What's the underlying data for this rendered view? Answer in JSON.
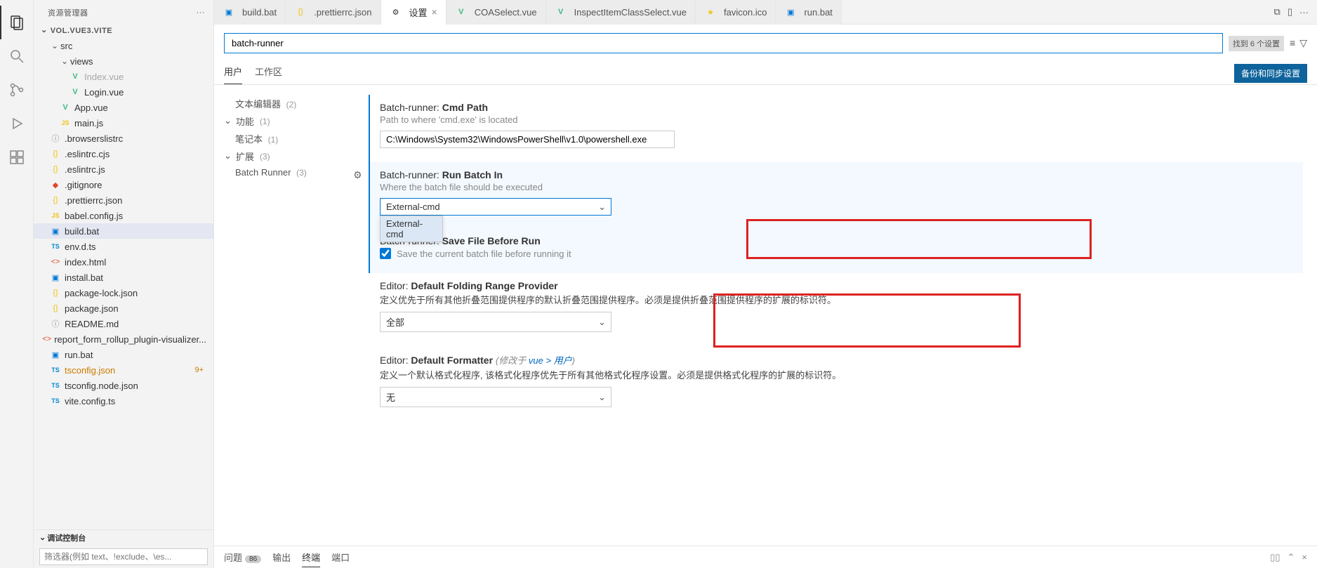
{
  "sidebar": {
    "title": "资源管理器",
    "root": "VOL.VUE3.VITE",
    "tree": [
      {
        "indent": 1,
        "type": "folder",
        "open": true,
        "label": "src"
      },
      {
        "indent": 2,
        "type": "folder",
        "open": true,
        "label": "views"
      },
      {
        "indent": 3,
        "type": "file",
        "icon": "vue",
        "label": "Index.vue",
        "dim": true
      },
      {
        "indent": 3,
        "type": "file",
        "icon": "vue",
        "label": "Login.vue"
      },
      {
        "indent": 2,
        "type": "file",
        "icon": "vue",
        "label": "App.vue"
      },
      {
        "indent": 2,
        "type": "file",
        "icon": "js",
        "label": "main.js"
      },
      {
        "indent": 1,
        "type": "file",
        "icon": "cfg",
        "label": ".browserslistrc"
      },
      {
        "indent": 1,
        "type": "file",
        "icon": "json",
        "label": ".eslintrc.cjs"
      },
      {
        "indent": 1,
        "type": "file",
        "icon": "json",
        "label": ".eslintrc.js"
      },
      {
        "indent": 1,
        "type": "file",
        "icon": "git",
        "label": ".gitignore"
      },
      {
        "indent": 1,
        "type": "file",
        "icon": "json",
        "label": ".prettierrc.json"
      },
      {
        "indent": 1,
        "type": "file",
        "icon": "js",
        "label": "babel.config.js"
      },
      {
        "indent": 1,
        "type": "file",
        "icon": "bat",
        "label": "build.bat",
        "selected": true
      },
      {
        "indent": 1,
        "type": "file",
        "icon": "ts",
        "label": "env.d.ts"
      },
      {
        "indent": 1,
        "type": "file",
        "icon": "html",
        "label": "index.html"
      },
      {
        "indent": 1,
        "type": "file",
        "icon": "bat",
        "label": "install.bat"
      },
      {
        "indent": 1,
        "type": "file",
        "icon": "json",
        "label": "package-lock.json"
      },
      {
        "indent": 1,
        "type": "file",
        "icon": "json",
        "label": "package.json"
      },
      {
        "indent": 1,
        "type": "file",
        "icon": "cfg",
        "label": "README.md"
      },
      {
        "indent": 1,
        "type": "file",
        "icon": "html",
        "label": "report_form_rollup_plugin-visualizer..."
      },
      {
        "indent": 1,
        "type": "file",
        "icon": "bat",
        "label": "run.bat"
      },
      {
        "indent": 1,
        "type": "file",
        "icon": "ts",
        "label": "tsconfig.json",
        "modified": true,
        "badge": "9+"
      },
      {
        "indent": 1,
        "type": "file",
        "icon": "ts",
        "label": "tsconfig.node.json"
      },
      {
        "indent": 1,
        "type": "file",
        "icon": "ts",
        "label": "vite.config.ts"
      }
    ],
    "outline_label": "调试控制台",
    "filter_placeholder": "筛选器(例如 text、!exclude、\\es..."
  },
  "tabs": [
    {
      "icon": "bat",
      "label": "build.bat"
    },
    {
      "icon": "json",
      "label": ".prettierrc.json"
    },
    {
      "icon": "gear",
      "label": "设置",
      "active": true,
      "close": true
    },
    {
      "icon": "vue",
      "label": "COASelect.vue"
    },
    {
      "icon": "vue",
      "label": "InspectItemClassSelect.vue"
    },
    {
      "icon": "star",
      "label": "favicon.ico"
    },
    {
      "icon": "bat",
      "label": "run.bat"
    }
  ],
  "settings": {
    "search_value": "batch-runner",
    "found_label": "找到 6 个设置",
    "scope_user": "用户",
    "scope_workspace": "工作区",
    "sync_button": "备份和同步设置",
    "nav": {
      "textEditor": "文本编辑器",
      "textEditorCount": "(2)",
      "features": "功能",
      "featuresCount": "(1)",
      "notebook": "笔记本",
      "notebookCount": "(1)",
      "extensions": "扩展",
      "extensionsCount": "(3)",
      "batchRunner": "Batch Runner",
      "batchRunnerCount": "(3)"
    },
    "items": {
      "cmdPath": {
        "cat": "Batch-runner:",
        "name": "Cmd Path",
        "desc": "Path to where 'cmd.exe' is located",
        "value": "C:\\Windows\\System32\\WindowsPowerShell\\v1.0\\powershell.exe"
      },
      "runBatchIn": {
        "cat": "Batch-runner:",
        "name": "Run Batch In",
        "desc": "Where the batch file should be executed",
        "value": "External-cmd",
        "option": "External-cmd"
      },
      "saveBeforeRun": {
        "cat": "Batch-runner:",
        "name": "Save File Before Run",
        "check_label": "Save the current batch file before running it"
      },
      "folding": {
        "cat": "Editor:",
        "name": "Default Folding Range Provider",
        "desc": "定义优先于所有其他折叠范围提供程序的默认折叠范围提供程序。必须是提供折叠范围提供程序的扩展的标识符。",
        "value": "全部"
      },
      "formatter": {
        "cat": "Editor:",
        "name": "Default Formatter",
        "note_prefix": "(修改于 ",
        "note_link": "vue > 用户",
        "note_suffix": ")",
        "desc": "定义一个默认格式化程序, 该格式化程序优先于所有其他格式化程序设置。必须是提供格式化程序的扩展的标识符。",
        "value": "无"
      }
    }
  },
  "panel": {
    "problems": "问题",
    "problems_count": "86",
    "output": "输出",
    "terminal": "终端",
    "ports": "端口"
  },
  "icons": {
    "vue": "V",
    "js": "JS",
    "json": "{}",
    "ts": "TS",
    "bat": "▣",
    "html": "<>",
    "git": "◆",
    "cfg": "ⓘ",
    "gear": "⚙",
    "star": "★"
  }
}
